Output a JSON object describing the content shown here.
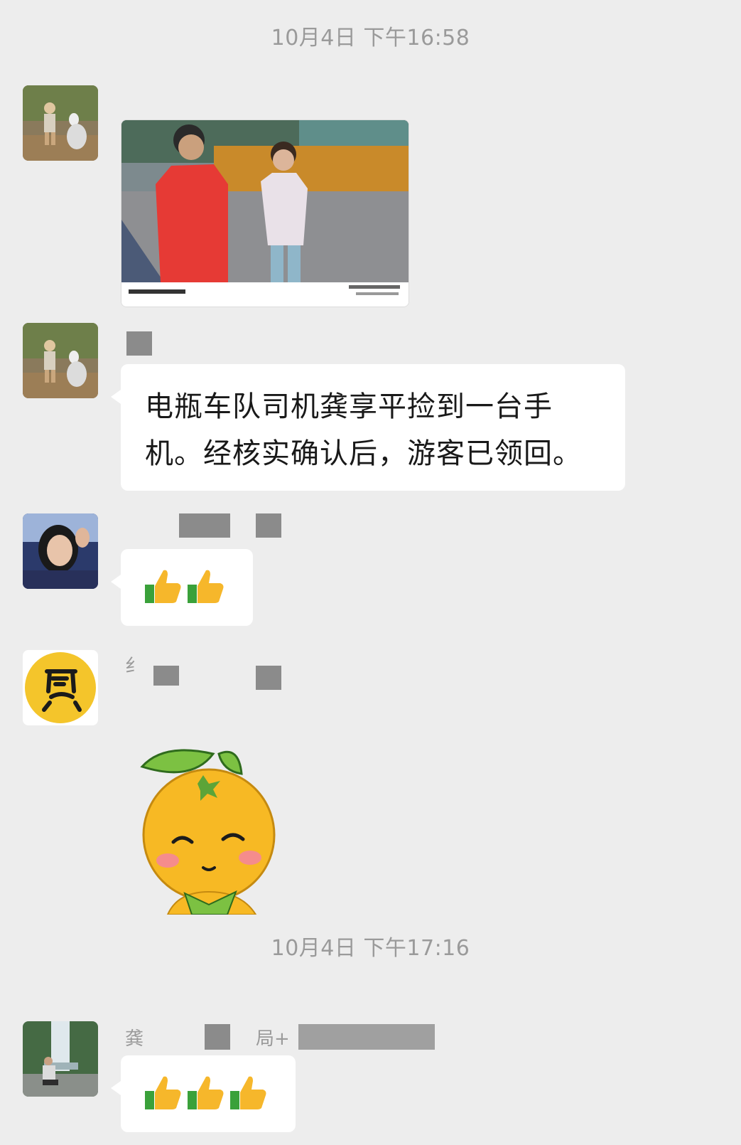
{
  "timestamps": [
    "10月4日 下午16:58",
    "10月4日 下午17:16"
  ],
  "messages": {
    "text_message": "电瓶车队司机龚享平捡到一台手机。经核实确认后，游客已领回。",
    "nick_partial_1": "纟",
    "nick_partial_2": "龚",
    "nick_partial_3": "局+"
  },
  "icons": {
    "thumbs_up": "thumbs-up-emoji",
    "sticker": "orange-mascot-sticker"
  },
  "colors": {
    "background": "#ededed",
    "bubble": "#ffffff",
    "timestamp_text": "#9a9a9a"
  }
}
